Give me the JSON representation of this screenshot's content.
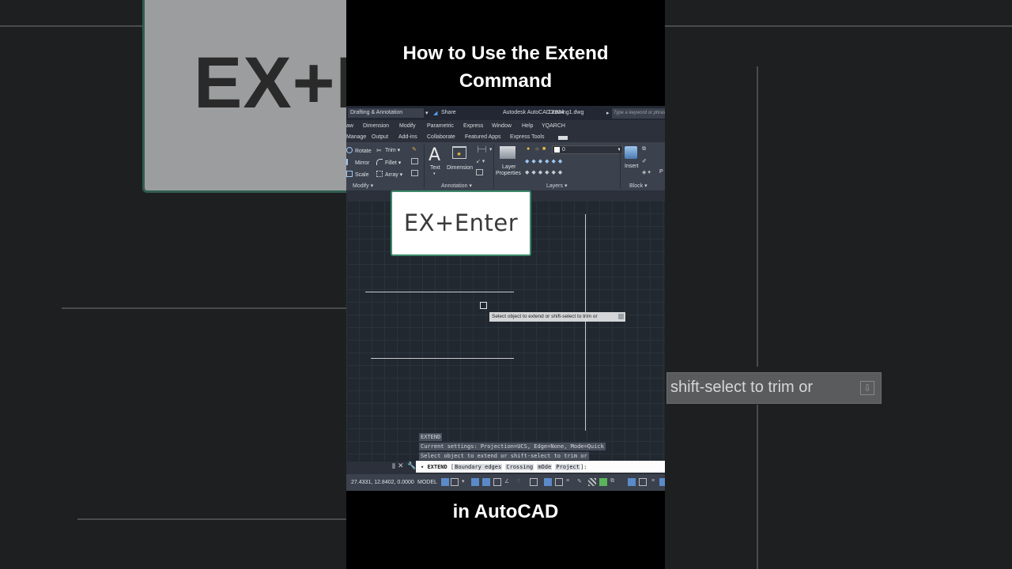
{
  "video": {
    "title": "How to Use the Extend Command",
    "subtitle": "in AutoCAD",
    "overlay_key": "EX+Enter"
  },
  "background": {
    "card_text": "EX+E",
    "tooltip_text": "shift-select to trim or"
  },
  "titlebar": {
    "workspace": "Drafting & Annotation",
    "share": "Share",
    "app_name": "Autodesk AutoCAD 2024",
    "document": "Drawing1.dwg",
    "search_placeholder": "Type a keyword or phrase"
  },
  "menubar": [
    "aw",
    "Dimension",
    "Modify",
    "Parametric",
    "Express",
    "Window",
    "Help",
    "YQARCH"
  ],
  "tabs": [
    "Manage",
    "Output",
    "Add-ins",
    "Collaborate",
    "Featured Apps",
    "Express Tools"
  ],
  "ribbon": {
    "modify": {
      "rotate": "Rotate",
      "trim": "Trim",
      "mirror": "Mirror",
      "fillet": "Fillet",
      "scale": "Scale",
      "array": "Array",
      "group": "Modify"
    },
    "annotation": {
      "text": "Text",
      "dimension": "Dimension",
      "group": "Annotation"
    },
    "layers": {
      "layer_properties_1": "Layer",
      "layer_properties_2": "Properties",
      "current_layer": "0",
      "group": "Layers"
    },
    "block": {
      "insert": "Insert",
      "group": "Block",
      "partial": "P"
    }
  },
  "canvas": {
    "tooltip": "Select object to extend or shift-select to trim or"
  },
  "command": {
    "history": [
      "EXTEND",
      "Current settings: Projection=UCS, Edge=None, Mode=Quick",
      "Select object to extend or shift-select to trim or"
    ],
    "prompt_prefix": "EXTEND",
    "options": [
      "Boundary edges",
      "Crossing",
      "mOde",
      "Project"
    ],
    "suffix": "]:"
  },
  "status": {
    "coordinates": "27.4331, 12.8402, 0.0000",
    "model": "MODEL"
  },
  "colors": {
    "accent_green": "#3c8a6b",
    "canvas": "#212830",
    "ribbon": "#3b414d"
  }
}
